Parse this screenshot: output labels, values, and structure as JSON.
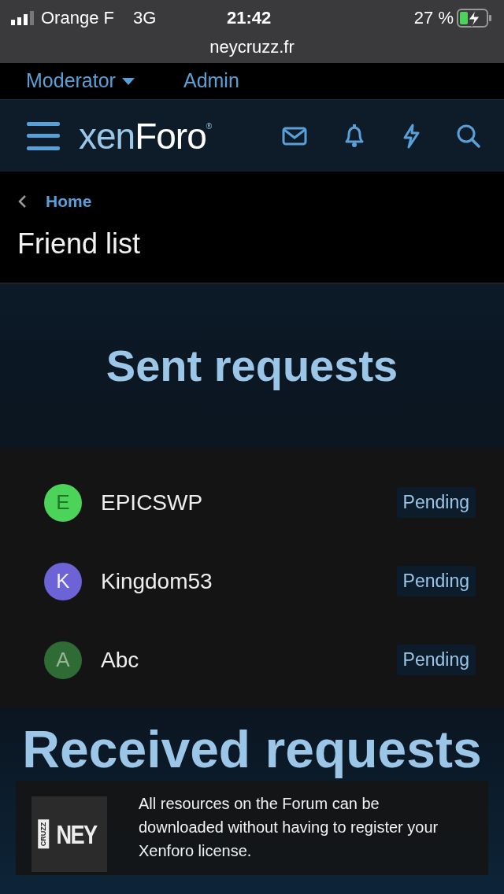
{
  "status_bar": {
    "carrier": "Orange F",
    "network": "3G",
    "time": "21:42",
    "battery": "27 %",
    "charging": true,
    "url": "neycruzz.fr"
  },
  "top_nav": [
    {
      "label": "Moderator",
      "dropdown": true
    },
    {
      "label": "Admin",
      "dropdown": false
    }
  ],
  "header": {
    "logo_parts": [
      "xen",
      "Foro",
      "®"
    ]
  },
  "breadcrumb": "Home",
  "page_title": "Friend list",
  "sections": [
    {
      "title": "Sent requests",
      "requests": [
        {
          "initial": "E",
          "name": "EPICSWP",
          "status": "Pending",
          "color": "#4cd35a"
        },
        {
          "initial": "K",
          "name": "Kingdom53",
          "status": "Pending",
          "color": "#6b63d6"
        },
        {
          "initial": "A",
          "name": "Abc",
          "status": "Pending",
          "color": "#2e6b35"
        }
      ]
    },
    {
      "title": "Received requests"
    }
  ],
  "notice": {
    "logo_small": "CRUZZ",
    "logo_big": "NEY",
    "text": "All resources on the Forum can be downloaded without having to register your Xenforo license."
  }
}
